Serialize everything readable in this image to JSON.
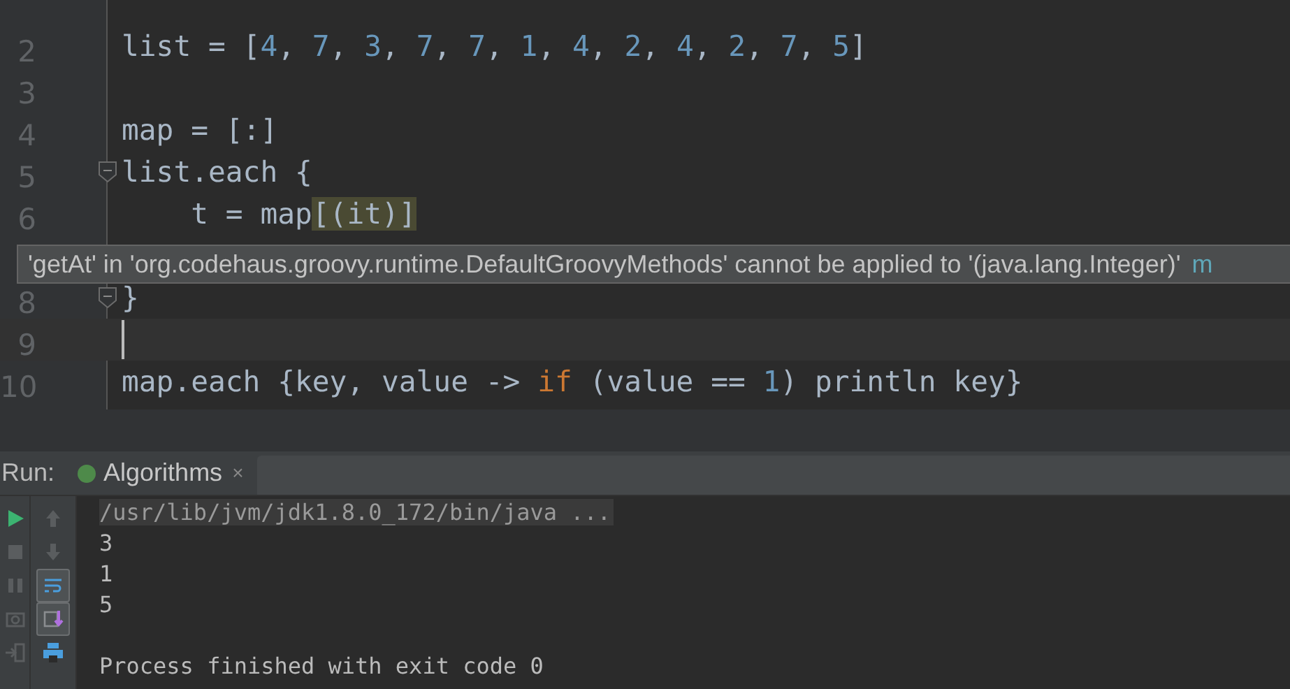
{
  "editor": {
    "lines": [
      {
        "kind": "code",
        "number": "2",
        "current": false,
        "fold": false,
        "tokens": [
          {
            "text": "list = [",
            "kind": "plain"
          },
          {
            "text": "4",
            "kind": "number"
          },
          {
            "text": ", ",
            "kind": "plain"
          },
          {
            "text": "7",
            "kind": "number"
          },
          {
            "text": ", ",
            "kind": "plain"
          },
          {
            "text": "3",
            "kind": "number"
          },
          {
            "text": ", ",
            "kind": "plain"
          },
          {
            "text": "7",
            "kind": "number"
          },
          {
            "text": ", ",
            "kind": "plain"
          },
          {
            "text": "7",
            "kind": "number"
          },
          {
            "text": ", ",
            "kind": "plain"
          },
          {
            "text": "1",
            "kind": "number"
          },
          {
            "text": ", ",
            "kind": "plain"
          },
          {
            "text": "4",
            "kind": "number"
          },
          {
            "text": ", ",
            "kind": "plain"
          },
          {
            "text": "2",
            "kind": "number"
          },
          {
            "text": ", ",
            "kind": "plain"
          },
          {
            "text": "4",
            "kind": "number"
          },
          {
            "text": ", ",
            "kind": "plain"
          },
          {
            "text": "2",
            "kind": "number"
          },
          {
            "text": ", ",
            "kind": "plain"
          },
          {
            "text": "7",
            "kind": "number"
          },
          {
            "text": ", ",
            "kind": "plain"
          },
          {
            "text": "5",
            "kind": "number"
          },
          {
            "text": "]",
            "kind": "plain"
          }
        ]
      },
      {
        "kind": "code",
        "number": "3",
        "current": false,
        "fold": false
      },
      {
        "kind": "code",
        "number": "4",
        "current": false,
        "fold": false,
        "tokens": [
          {
            "text": "map = [:]",
            "kind": "plain"
          }
        ]
      },
      {
        "kind": "code",
        "number": "5",
        "current": false,
        "fold": true,
        "tokens": [
          {
            "text": "list.each {",
            "kind": "plain"
          }
        ]
      },
      {
        "kind": "code",
        "number": "6",
        "current": false,
        "fold": false,
        "tokens": [
          {
            "text": "    t = map",
            "kind": "plain"
          },
          {
            "text": "[(it)]",
            "kind": "match"
          }
        ]
      },
      {
        "kind": "tooltip",
        "text": "'getAt' in 'org.codehaus.groovy.runtime.DefaultGroovyMethods' cannot be applied to '(java.lang.Integer)'",
        "link": "m"
      },
      {
        "kind": "code",
        "number": "8",
        "current": false,
        "fold": true,
        "tokens": [
          {
            "text": "}",
            "kind": "plain"
          }
        ]
      },
      {
        "kind": "code",
        "number": "9",
        "current": true,
        "fold": false
      },
      {
        "kind": "code",
        "number": "10",
        "current": false,
        "fold": false,
        "tokens": [
          {
            "text": "map.each {key, value -> ",
            "kind": "plain"
          },
          {
            "text": "if",
            "kind": "keyword"
          },
          {
            "text": " (value == ",
            "kind": "plain"
          },
          {
            "text": "1",
            "kind": "number"
          },
          {
            "text": ") println key}",
            "kind": "plain"
          }
        ]
      }
    ]
  },
  "run_panel": {
    "label": "Run:",
    "tabs": [
      {
        "label": "Algorithms",
        "selected": true,
        "close": "×"
      }
    ],
    "left_tools": [
      {
        "kind": "run",
        "disabled": false
      },
      {
        "kind": "stop",
        "disabled": true
      },
      {
        "kind": "pause",
        "disabled": true
      },
      {
        "kind": "camera",
        "disabled": true
      },
      {
        "kind": "exit",
        "disabled": true
      }
    ],
    "right_tools": [
      {
        "kind": "up",
        "on": false
      },
      {
        "kind": "down",
        "on": false
      },
      {
        "kind": "wrap",
        "on": true
      },
      {
        "kind": "scroll",
        "on": true
      },
      {
        "kind": "print",
        "on": false
      }
    ],
    "console": [
      {
        "text": "/usr/lib/jvm/jdk1.8.0_172/bin/java ...",
        "kind": "command"
      },
      {
        "text": "3",
        "kind": "output"
      },
      {
        "text": "1",
        "kind": "output"
      },
      {
        "text": "5",
        "kind": "output"
      },
      {
        "kind": "blank"
      },
      {
        "text": "Process finished with exit code 0",
        "kind": "output"
      }
    ]
  }
}
